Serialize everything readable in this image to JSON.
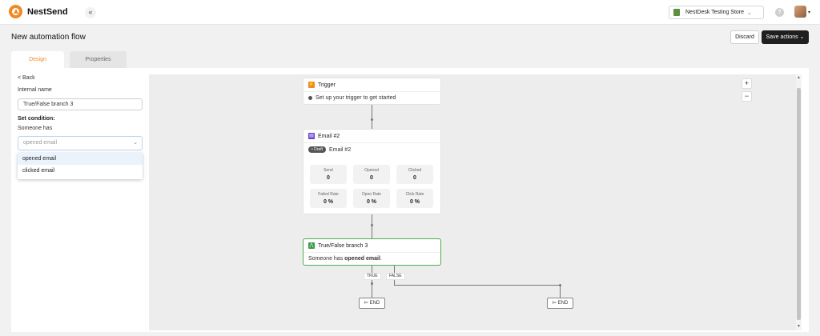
{
  "app": {
    "name": "NestSend",
    "collapse_icon": "«"
  },
  "store": {
    "label": "NestDesk Testing Store",
    "chevron": "⌄"
  },
  "header": {
    "help_icon": "?",
    "avatar_caret": "▾"
  },
  "page": {
    "title": "New automation flow",
    "discard_label": "Discard",
    "save_label": "Save actions ⌄"
  },
  "tabs": [
    {
      "label": "Design"
    },
    {
      "label": "Properties"
    }
  ],
  "sidebar": {
    "back": "< Back",
    "internal_name_label": "Internal name",
    "internal_name_value": "True/False branch 3",
    "set_condition_label": "Set condition:",
    "someone_has_label": "Someone has",
    "condition_placeholder": "opened email",
    "condition_chevron": "⌄",
    "options": [
      "opened email",
      "clicked email"
    ]
  },
  "canvas": {
    "zoom_in": "+",
    "zoom_out": "−",
    "trigger": {
      "title": "Trigger",
      "message": "Set up your trigger to get started"
    },
    "email": {
      "title": "Email #2",
      "badge": "• Draft",
      "subtitle": "Email #2",
      "stats": [
        {
          "label": "Send",
          "value": "0"
        },
        {
          "label": "Opened",
          "value": "0"
        },
        {
          "label": "Clicked",
          "value": "0"
        },
        {
          "label": "Failed Rate",
          "value": "0 %"
        },
        {
          "label": "Open Rate",
          "value": "0 %"
        },
        {
          "label": "Click Rate",
          "value": "0 %"
        }
      ]
    },
    "branch": {
      "title": "True/False branch 3",
      "prefix": "Someone has ",
      "condition": "opened email",
      "suffix": "."
    },
    "true_label": "TRUE",
    "false_label": "FALSE",
    "end_label": "⊨ END"
  },
  "scroll": {
    "up": "▲",
    "down": "▼"
  },
  "colors": {
    "brand": "#f08a24",
    "trigger": "#f08a24",
    "email": "#6b3fd1",
    "branch": "#3a9a4a"
  }
}
